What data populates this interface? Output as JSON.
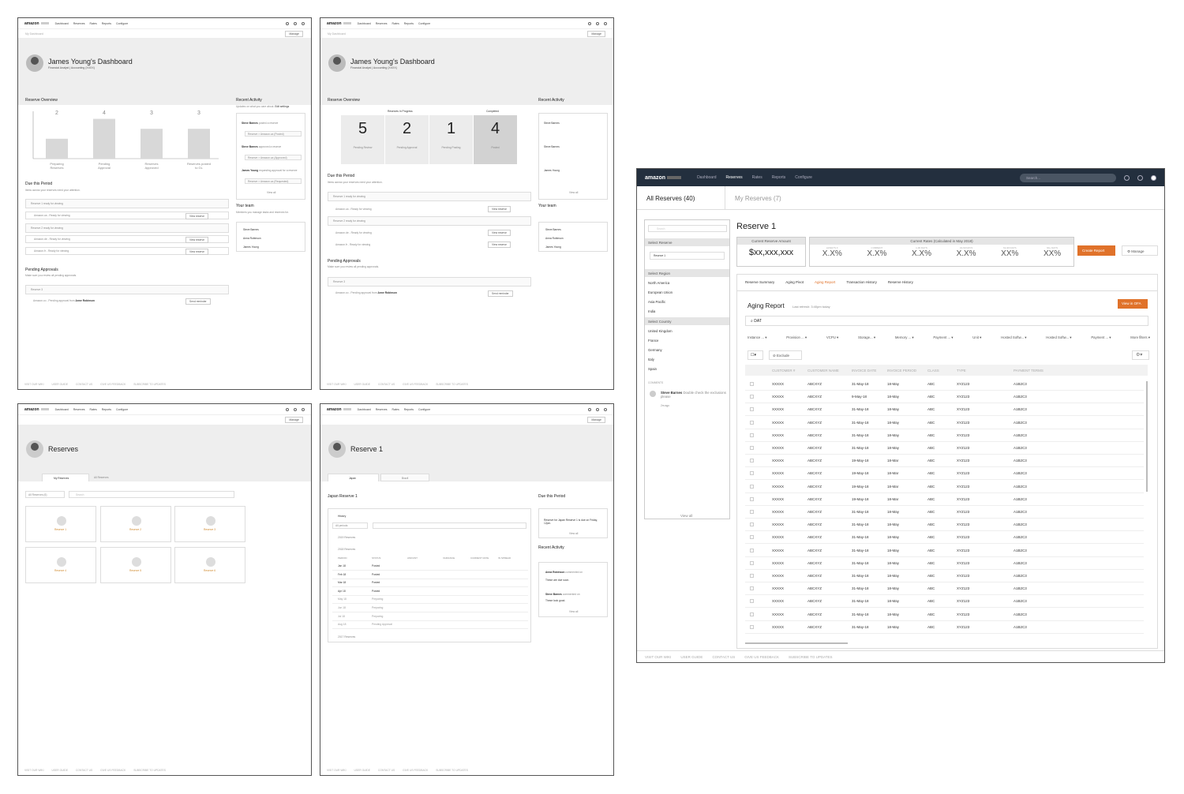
{
  "nav": {
    "logo": "amazon",
    "links": [
      "Dashboard",
      "Reserves",
      "Rates",
      "Reports",
      "Configure"
    ],
    "manage": "Manage",
    "breadcrumb": "My Dashboard"
  },
  "dashboard": {
    "title": "James Young's Dashboard",
    "subtitle": "Financial Analyst | Accounting (XXXX)",
    "reserve_overview": "Reserve Overview",
    "due_title": "Due this Period",
    "due_desc": "Items across your reserves need your attention.",
    "learn_more": "Learn more",
    "pending_title": "Pending Approvals",
    "pending_desc": "Make sure you review all pending approvals.",
    "recent_title": "Recent Activity",
    "recent_desc": "Updates on what you care about.",
    "edit_settings": "Edit settings",
    "your_team": "Your team",
    "team_desc": "Members you manage tasks and reserves for.",
    "team": [
      "Steve Barnes",
      "Anna Robinson",
      "James Young"
    ],
    "view_all": "View all",
    "view_reserve": "View reserve",
    "send_reminder": "Send reminder",
    "due_rows": [
      "Reserve 1 ready for viewing",
      "Reserve 2 ready for viewing"
    ],
    "due_sub": [
      "Amazon.ca - Ready for viewing",
      "Amazon.de - Ready for viewing",
      "Amazon.fr - Ready for viewing"
    ],
    "pending_row": "Reserve 3",
    "pending_sub": "Amazon.co - Pending approval from",
    "pending_name": "Anne Robinson",
    "activity": [
      {
        "name": "Steve Barnes",
        "text": "posted a reserve",
        "chip": "Reserve > Amazon.ca (Posted)"
      },
      {
        "name": "Steve Barnes",
        "text": "approved a reserve",
        "chip": "Reserve > Amazon.ca (Approved)"
      },
      {
        "name": "James Young",
        "text": "requesting approval for a reserve",
        "chip": "Reserve > Amazon.ca (Requested)"
      }
    ]
  },
  "chart_data": {
    "type": "bar",
    "categories": [
      "Preparing Reserves",
      "Pending Approval",
      "Reserves Approved",
      "Reserves posted to GL"
    ],
    "values": [
      2,
      4,
      3,
      3
    ],
    "ylim": [
      0,
      10
    ]
  },
  "progress": {
    "in_progress_label": "Reserves In Progress",
    "completed_label": "Completed",
    "stats": [
      {
        "value": "5",
        "label": "Pending Review"
      },
      {
        "value": "2",
        "label": "Pending Approval"
      },
      {
        "value": "1",
        "label": "Pending Posting"
      },
      {
        "value": "4",
        "label": "Posted"
      }
    ]
  },
  "reserves": {
    "title": "Reserves",
    "tabs": [
      "My Reserves",
      "All Reserves"
    ],
    "filter": "All Reserves (6)",
    "search": "Search",
    "cards": [
      "Reserve 1",
      "Reserve 2",
      "Reserve 3",
      "Reserve 4",
      "Reserve 5",
      "Reserve 6"
    ]
  },
  "reserve1": {
    "title": "Reserve 1",
    "tabs": [
      "Japan",
      "Brazil"
    ],
    "subtitle": "Japan Reserve 1",
    "history": "History",
    "period_filter": "All periods",
    "year2019": "2019 Reserves",
    "year2018": "2018 Reserves",
    "year2017": "2017 Reserves",
    "columns": [
      "PERIOD",
      "STATUS",
      "AMOUNT",
      "VARIANCE",
      "CURRENT RATE",
      "IN SPREAD"
    ],
    "rows": [
      [
        "Jan 18",
        "Posted"
      ],
      [
        "Feb 18",
        "Posted"
      ],
      [
        "Mar 18",
        "Posted"
      ],
      [
        "Apr 18",
        "Posted"
      ],
      [
        "May 18",
        "Preparing"
      ],
      [
        "Jun 18",
        "Preparing"
      ],
      [
        "Jul 18",
        "Preparing"
      ],
      [
        "Aug 18",
        "Pending Approval"
      ]
    ],
    "due_note": "Reserve for Japan Reserve 1 is due on Friday, 12pm.",
    "activity": [
      {
        "name": "Anna Robinson",
        "text": "commented on",
        "note": "These are due soon."
      },
      {
        "name": "Steve Barnes",
        "text": "commented on",
        "note": "These look good."
      }
    ]
  },
  "aging": {
    "nav_links": [
      "Dashboard",
      "Reserves",
      "Rates",
      "Reports",
      "Configure"
    ],
    "search": "Search...",
    "tabs": [
      "All Reserves (40)",
      "My Reserves (7)"
    ],
    "search_side": "Search",
    "select_reserve": "Select Reserve",
    "reserve_value": "Reserve 1",
    "select_region": "Select Region",
    "regions": [
      "North America",
      "European Union",
      "Asia Pacific",
      "India"
    ],
    "select_country": "Select Country",
    "countries": [
      "United Kingdom",
      "France",
      "Germany",
      "Italy",
      "Spain"
    ],
    "comments": "COMMENTS",
    "comment_name": "Steve Barnes",
    "comment_text": "Double check the exclusions please",
    "comment_time": "2m ago",
    "view_all": "View all",
    "title": "Reserve 1",
    "current_amount_label": "Current Reserve Amount",
    "current_amount": "$xx,xxx,xxx",
    "rates_label": "Current Rates (Calculated in May 2018)",
    "rate_headers": [
      "ALWAYS X",
      "CURRENT",
      "1-30 DAYS",
      "31-60 DAYS",
      "61-90 DAYS",
      "90+ DAYS"
    ],
    "rates": [
      "X.X%",
      "X.X%",
      "X.X%",
      "X.X%",
      "XX%",
      "XX%"
    ],
    "create_report": "Create Report",
    "manage": "Manage",
    "subtabs": [
      "Reserve Summary",
      "Aging Pivot",
      "Aging Report",
      "Transaction History",
      "Reserve History"
    ],
    "report_title": "Aging Report",
    "last_refresh": "Last refresh: 3:40pm today",
    "view_ofa": "View in OFA",
    "query": "DAT",
    "filters": [
      "Instance ...",
      "Provision ...",
      "VCPU",
      "Storage...",
      "Memory ...",
      "Payment ...",
      "Unit",
      "Hosted Softw...",
      "Hosted Softw...",
      "Payment ...",
      "More filters"
    ],
    "exclude": "Exclude",
    "columns": [
      "CUSTOMER #",
      "CUSTOMER NAME",
      "INVOICE DATE",
      "INVOICE PERIOD",
      "CLASS",
      "TYPE",
      "PAYMENT TERMS"
    ],
    "rows": [
      [
        "XXXXX",
        "ABCXYZ",
        "31-May-18",
        "18-May",
        "ABC",
        "XYZ123",
        "A1B2C3"
      ],
      [
        "XXXXX",
        "ABCXYZ",
        "9-May-18",
        "18-May",
        "ABC",
        "XYZ123",
        "A1B2C3"
      ],
      [
        "XXXXX",
        "ABCXYZ",
        "31-May-18",
        "18-May",
        "ABC",
        "XYZ123",
        "A1B2C3"
      ],
      [
        "XXXXX",
        "ABCXYZ",
        "31-May-18",
        "18-May",
        "ABC",
        "XYZ123",
        "A1B2C3"
      ],
      [
        "XXXXX",
        "ABCXYZ",
        "31-May-18",
        "18-May",
        "ABC",
        "XYZ123",
        "A1B2C3"
      ],
      [
        "XXXXX",
        "ABCXYZ",
        "31-May-18",
        "18-May",
        "ABC",
        "XYZ123",
        "A1B2C3"
      ],
      [
        "XXXXX",
        "ABCXYZ",
        "19-May-18",
        "18-Mar",
        "ABC",
        "XYZ123",
        "A1B2C3"
      ],
      [
        "XXXXX",
        "ABCXYZ",
        "19-May-18",
        "18-Mar",
        "ABC",
        "XYZ123",
        "A1B2C3"
      ],
      [
        "XXXXX",
        "ABCXYZ",
        "19-May-18",
        "18-Mar",
        "ABC",
        "XYZ123",
        "A1B2C3"
      ],
      [
        "XXXXX",
        "ABCXYZ",
        "19-May-18",
        "18-Mar",
        "ABC",
        "XYZ123",
        "A1B2C3"
      ],
      [
        "XXXXX",
        "ABCXYZ",
        "31-May-18",
        "18-May",
        "ABC",
        "XYZ123",
        "A1B2C3"
      ],
      [
        "XXXXX",
        "ABCXYZ",
        "31-May-18",
        "18-May",
        "ABC",
        "XYZ123",
        "A1B2C3"
      ],
      [
        "XXXXX",
        "ABCXYZ",
        "31-May-18",
        "18-May",
        "ABC",
        "XYZ123",
        "A1B2C3"
      ],
      [
        "XXXXX",
        "ABCXYZ",
        "31-May-18",
        "18-May",
        "ABC",
        "XYZ123",
        "A1B2C3"
      ],
      [
        "XXXXX",
        "ABCXYZ",
        "31-May-18",
        "18-May",
        "ABC",
        "XYZ123",
        "A1B2C3"
      ],
      [
        "XXXXX",
        "ABCXYZ",
        "31-May-18",
        "18-May",
        "ABC",
        "XYZ123",
        "A1B2C3"
      ],
      [
        "XXXXX",
        "ABCXYZ",
        "31-May-18",
        "18-May",
        "ABC",
        "XYZ123",
        "A1B2C3"
      ],
      [
        "XXXXX",
        "ABCXYZ",
        "31-May-18",
        "18-May",
        "ABC",
        "XYZ123",
        "A1B2C3"
      ],
      [
        "XXXXX",
        "ABCXYZ",
        "31-May-18",
        "18-May",
        "ABC",
        "XYZ123",
        "A1B2C3"
      ],
      [
        "XXXXX",
        "ABCXYZ",
        "31-May-18",
        "18-May",
        "ABC",
        "XYZ123",
        "A1B2C3"
      ]
    ],
    "footer": [
      "VISIT OUR WIKI",
      "USER GUIDE",
      "CONTACT US",
      "GIVE US FEEDBACK",
      "SUBSCRIBE TO UPDATES"
    ],
    "accent": "#e0722a",
    "nav_bg": "#232f3e"
  }
}
